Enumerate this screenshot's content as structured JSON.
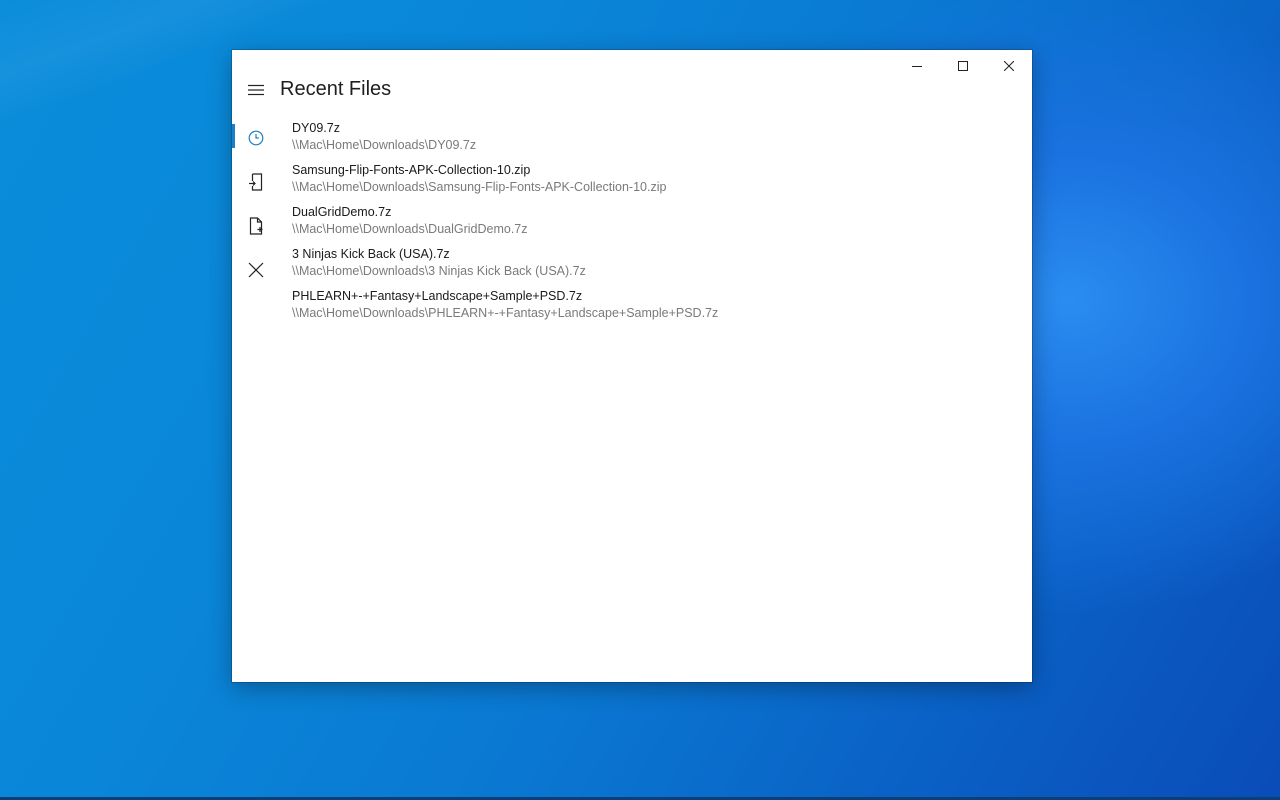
{
  "window": {
    "title": "Recent Files",
    "caption": {
      "minimize_icon": "minimize-icon",
      "maximize_icon": "maximize-icon",
      "close_icon": "close-icon"
    }
  },
  "nav": {
    "menu_icon": "hamburger-icon",
    "items": [
      {
        "icon": "clock-icon",
        "selected": true
      },
      {
        "icon": "open-file-icon",
        "selected": false
      },
      {
        "icon": "new-file-icon",
        "selected": false
      },
      {
        "icon": "close-icon",
        "selected": false
      }
    ]
  },
  "colors": {
    "accent": "#1d7fc4",
    "path_text": "#7a7a7a"
  },
  "files": [
    {
      "name": "DY09.7z",
      "path": "\\\\Mac\\Home\\Downloads\\DY09.7z"
    },
    {
      "name": "Samsung-Flip-Fonts-APK-Collection-10.zip",
      "path": "\\\\Mac\\Home\\Downloads\\Samsung-Flip-Fonts-APK-Collection-10.zip"
    },
    {
      "name": "DualGridDemo.7z",
      "path": "\\\\Mac\\Home\\Downloads\\DualGridDemo.7z"
    },
    {
      "name": "3 Ninjas Kick Back (USA).7z",
      "path": "\\\\Mac\\Home\\Downloads\\3 Ninjas Kick Back (USA).7z"
    },
    {
      "name": "PHLEARN+-+Fantasy+Landscape+Sample+PSD.7z",
      "path": "\\\\Mac\\Home\\Downloads\\PHLEARN+-+Fantasy+Landscape+Sample+PSD.7z"
    }
  ]
}
